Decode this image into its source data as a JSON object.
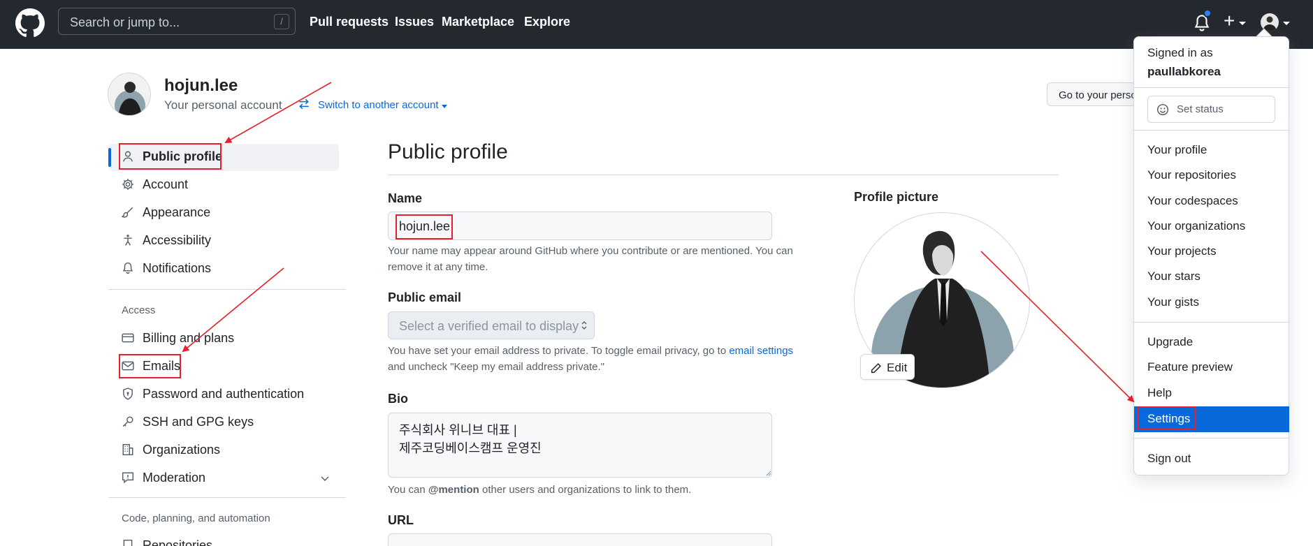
{
  "header": {
    "search_placeholder": "Search or jump to...",
    "search_shortcut": "/",
    "nav": [
      "Pull requests",
      "Issues",
      "Marketplace",
      "Explore"
    ],
    "plus": "+"
  },
  "account": {
    "name": "hojun.lee",
    "subtitle": "Your personal account",
    "switch_link": "Switch to another account",
    "goto_button": "Go to your personal profile"
  },
  "sidebar": {
    "items": [
      {
        "label": "Public profile",
        "icon": "person-icon"
      },
      {
        "label": "Account",
        "icon": "gear-icon"
      },
      {
        "label": "Appearance",
        "icon": "paintbrush-icon"
      },
      {
        "label": "Accessibility",
        "icon": "accessibility-icon"
      },
      {
        "label": "Notifications",
        "icon": "bell-icon"
      }
    ],
    "access_heading": "Access",
    "access_items": [
      {
        "label": "Billing and plans",
        "icon": "credit-card-icon"
      },
      {
        "label": "Emails",
        "icon": "mail-icon"
      },
      {
        "label": "Password and authentication",
        "icon": "shield-lock-icon"
      },
      {
        "label": "SSH and GPG keys",
        "icon": "key-icon"
      },
      {
        "label": "Organizations",
        "icon": "organization-icon"
      },
      {
        "label": "Moderation",
        "icon": "report-icon"
      }
    ],
    "code_heading": "Code, planning, and automation",
    "code_items": [
      {
        "label": "Repositories",
        "icon": "repo-icon"
      }
    ]
  },
  "main": {
    "title": "Public profile",
    "name_label": "Name",
    "name_value": "hojun.lee",
    "name_note": "Your name may appear around GitHub where you contribute or are mentioned. You can remove it at any time.",
    "email_label": "Public email",
    "email_placeholder": "Select a verified email to display",
    "email_note_1": "You have set your email address to private. To toggle email privacy, go to",
    "email_note_link": "email settings",
    "email_note_2": "and uncheck \"Keep my email address private.\"",
    "bio_label": "Bio",
    "bio_line1": "주식회사 위니브 대표 |",
    "bio_line2": "제주코딩베이스캠프 운영진",
    "bio_note_1": "You can",
    "bio_note_mention": "@mention",
    "bio_note_2": "other users and organizations to link to them.",
    "url_label": "URL",
    "profile_picture_label": "Profile picture",
    "edit_button": "Edit"
  },
  "menu": {
    "signed_in_as": "Signed in as",
    "username": "paullabkorea",
    "set_status": "Set status",
    "group1": [
      "Your profile",
      "Your repositories",
      "Your codespaces",
      "Your organizations",
      "Your projects",
      "Your stars",
      "Your gists"
    ],
    "group2": [
      "Upgrade",
      "Feature preview",
      "Help",
      "Settings"
    ],
    "sign_out": "Sign out"
  },
  "colors": {
    "header_bg": "#24292f",
    "accent": "#0969da",
    "annotation_red": "#e5202d"
  }
}
